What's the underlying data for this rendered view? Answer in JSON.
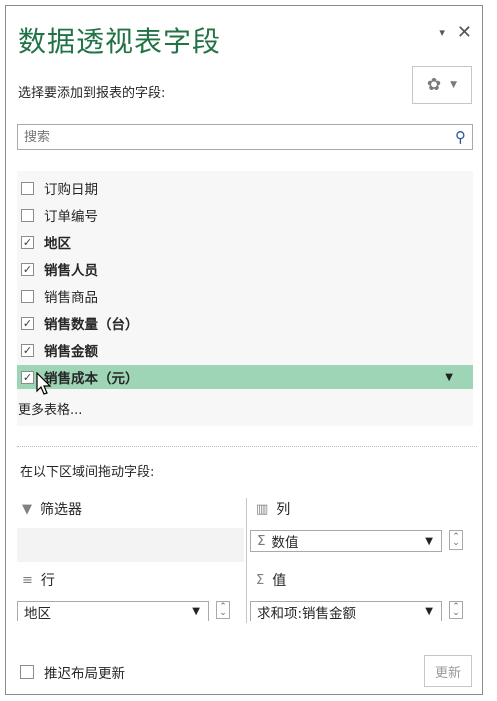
{
  "pane": {
    "title": "数据透视表字段",
    "dropdown_icon": "▾",
    "close_icon": "✕"
  },
  "chooser": {
    "label": "选择要添加到报表的字段:",
    "gear_icon": "gear-icon"
  },
  "search": {
    "placeholder": "搜索",
    "icon": "search-icon"
  },
  "fields": [
    {
      "label": "订购日期",
      "checked": false
    },
    {
      "label": "订单编号",
      "checked": false
    },
    {
      "label": "地区",
      "checked": true
    },
    {
      "label": "销售人员",
      "checked": true
    },
    {
      "label": "销售商品",
      "checked": false
    },
    {
      "label": "销售数量（台）",
      "checked": true
    },
    {
      "label": "销售金额",
      "checked": true
    },
    {
      "label": "销售成本（元）",
      "checked": true,
      "highlighted": true
    }
  ],
  "more_tables": "更多表格...",
  "drag_label": "在以下区域间拖动字段:",
  "areas": {
    "filters": {
      "label": "筛选器"
    },
    "columns": {
      "label": "列",
      "items": [
        "数值"
      ]
    },
    "rows": {
      "label": "行",
      "items": [
        "地区"
      ]
    },
    "values": {
      "label": "值",
      "items": [
        "求和项:销售金额"
      ]
    }
  },
  "footer": {
    "defer_label": "推迟布局更新",
    "update_label": "更新"
  },
  "colors": {
    "title_green": "#217346",
    "highlight": "#9fd5b7"
  }
}
